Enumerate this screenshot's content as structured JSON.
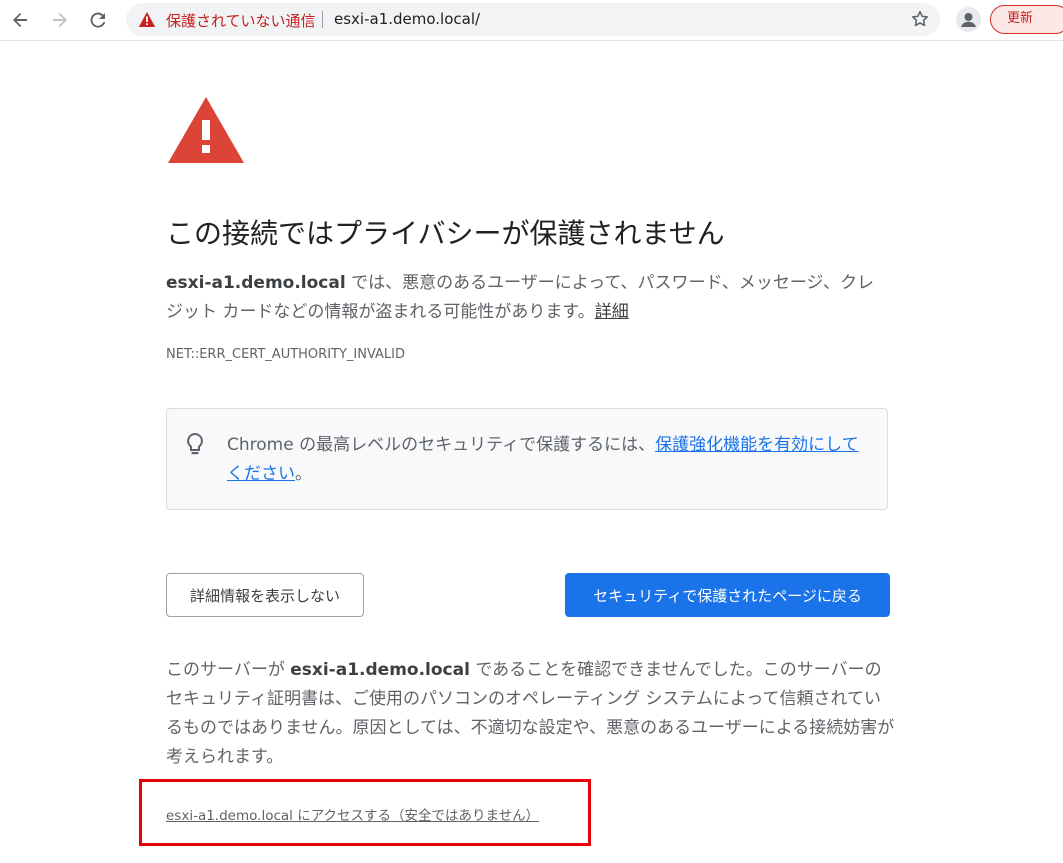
{
  "toolbar": {
    "not_secure_label": "保護されていない通信",
    "url": "esxi-a1.demo.local/",
    "update_label": "更新",
    "icons": [
      "back-arrow-icon",
      "forward-arrow-icon",
      "reload-icon",
      "warning-triangle-icon",
      "star-icon",
      "account-icon"
    ]
  },
  "interstitial": {
    "heading": "この接続ではプライバシーが保護されません",
    "explanation": {
      "host": "esxi-a1.demo.local",
      "text": " では、悪意のあるユーザーによって、パスワード、メッセージ、クレジット カードなどの情報が盗まれる可能性があります。",
      "learn_more": "詳細"
    },
    "error_code": "NET::ERR_CERT_AUTHORITY_INVALID",
    "enhanced_protection": {
      "text_before": "Chrome の最高レベルのセキュリティで保護するには、",
      "link": "保護強化機能を有効にしてください",
      "text_after": "。"
    },
    "buttons": {
      "hide_details": "詳細情報を表示しない",
      "back_to_safety": "セキュリティで保護されたページに戻る"
    },
    "details": {
      "text_before": "このサーバーが ",
      "host": "esxi-a1.demo.local",
      "text_after": " であることを確認できませんでした。このサーバーのセキュリティ証明書は、ご使用のパソコンのオペレーティング システムによって信頼されているものではありません。原因としては、不適切な設定や、悪意のあるユーザーによる接続妨害が考えられます。"
    },
    "proceed_link": "esxi-a1.demo.local にアクセスする（安全ではありません）"
  },
  "colors": {
    "danger_red": "#db4437",
    "link_blue": "#1a73e8",
    "primary_button": "#1a73e8",
    "highlight_frame": "#e8000b",
    "not_secure_text": "#c5221f"
  }
}
